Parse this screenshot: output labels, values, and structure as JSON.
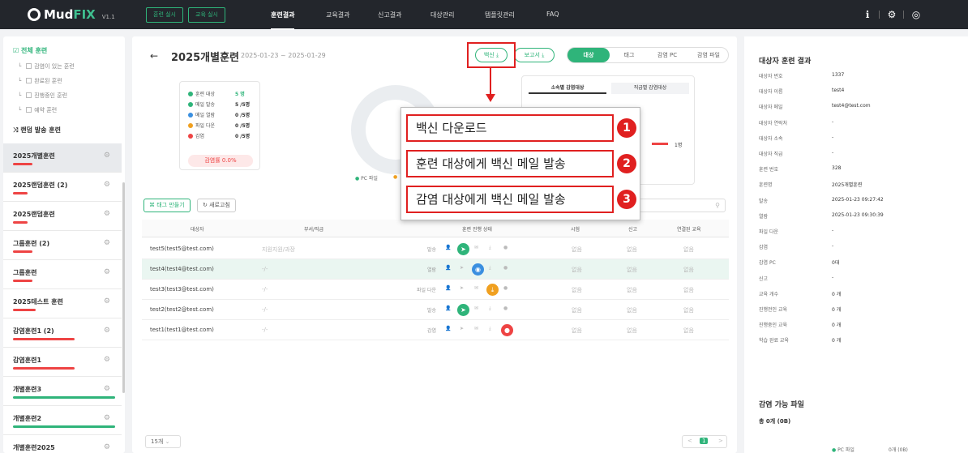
{
  "topbar": {
    "logo": "MudFIX",
    "version": "V1.1",
    "btn_training": "훈련 실시",
    "btn_education": "교육 실시",
    "nav": [
      "훈련결과",
      "교육결과",
      "신고결과",
      "대상관리",
      "템플릿관리",
      "FAQ"
    ]
  },
  "sidebar": {
    "all_training": "전체 훈련",
    "subs": [
      "감염이 있는 훈련",
      "완료된 훈련",
      "진행중인 훈련",
      "예약 훈련"
    ],
    "random": "랜덤 발송 훈련",
    "items": [
      {
        "name": "2025개별훈련",
        "bar": "#e44",
        "barw": 24
      },
      {
        "name": "2025랜덤훈련 (2)",
        "bar": "#e44",
        "barw": 18
      },
      {
        "name": "2025랜덤훈련",
        "bar": "#e44",
        "barw": 18
      },
      {
        "name": "그룹훈련 (2)",
        "bar": "#e44",
        "barw": 24
      },
      {
        "name": "그룹훈련",
        "bar": "#e44",
        "barw": 24
      },
      {
        "name": "2025테스트 훈련",
        "bar": "#e44",
        "barw": 28
      },
      {
        "name": "감염훈련1 (2)",
        "bar": "#e44",
        "barw": 76
      },
      {
        "name": "감염훈련1",
        "bar": "#e44",
        "barw": 76
      },
      {
        "name": "개별훈련3",
        "bar": "#2fb47a",
        "barw": 126
      },
      {
        "name": "개별훈련2",
        "bar": "#2fb47a",
        "barw": 126
      },
      {
        "name": "개별훈련2025",
        "bar": "#2fb47a",
        "barw": 126
      }
    ]
  },
  "main": {
    "title": "2025개별훈련",
    "dates": "2025-01-23 ~ 2025-01-29",
    "btn_vaccine": "백신 ⤓",
    "btn_report": "보고서 ⤓",
    "toggle": [
      "대상",
      "태그",
      "감염 PC",
      "감염 파일"
    ],
    "stats": [
      {
        "label": "훈련 대상",
        "value": "5 명",
        "color": "#2fb47a"
      },
      {
        "label": "메일 발송",
        "value": "5 /5명",
        "color": "#2fb47a"
      },
      {
        "label": "메일 열람",
        "value": "0 /5명",
        "color": "#3a8fe0"
      },
      {
        "label": "파일 다운",
        "value": "0 /5명",
        "color": "#f0a020"
      },
      {
        "label": "감염",
        "value": "0 /5명",
        "color": "#e44"
      }
    ],
    "infection_rate": "감염률 0.0%",
    "legend_pc": "PC 파일",
    "rtabs": [
      "소속별 감염대상",
      "직급별 감염대상"
    ],
    "rbar_label": "1명",
    "btn_tag": "태그 만들기",
    "btn_refresh": "새로고침",
    "headers": [
      "대상자",
      "부서/직급",
      "훈련 진행 상태",
      "시험",
      "신고",
      "연결된 교육"
    ],
    "rows": [
      {
        "name": "test5(test5@test.com)",
        "dept": "지원지원/과장",
        "status": "발송",
        "step": 1,
        "col": "#2fb47a",
        "icon": "➤",
        "c1": "없음",
        "c2": "없음",
        "c3": "없음"
      },
      {
        "name": "test4(test4@test.com)",
        "dept": "-/-",
        "status": "열람",
        "step": 2,
        "col": "#3a8fe0",
        "icon": "◉",
        "c1": "없음",
        "c2": "없음",
        "c3": "없음"
      },
      {
        "name": "test3(test3@test.com)",
        "dept": "-/-",
        "status": "파일 다운",
        "step": 3,
        "col": "#f0a020",
        "icon": "⤓",
        "c1": "없음",
        "c2": "없음",
        "c3": "없음"
      },
      {
        "name": "test2(test2@test.com)",
        "dept": "-/-",
        "status": "발송",
        "step": 1,
        "col": "#2fb47a",
        "icon": "➤",
        "c1": "없음",
        "c2": "없음",
        "c3": "없음"
      },
      {
        "name": "test1(test1@test.com)",
        "dept": "-/-",
        "status": "감염",
        "step": 4,
        "col": "#e44",
        "icon": "●",
        "c1": "없음",
        "c2": "없음",
        "c3": "없음"
      }
    ],
    "page_size": "15개",
    "page": "1"
  },
  "right": {
    "title": "대상자 훈련 결과",
    "fields": [
      [
        "대상자 번호",
        "1337"
      ],
      [
        "대상자 이름",
        "test4"
      ],
      [
        "대상자 메일",
        "test4@test.com"
      ],
      [
        "대상자 연락처",
        "-"
      ],
      [
        "대상자 소속",
        "-"
      ],
      [
        "대상자 직급",
        "-"
      ],
      [
        "훈련 번호",
        "328"
      ],
      [
        "훈련명",
        "2025개별훈련"
      ],
      [
        "발송",
        "2025-01-23 09:27:42"
      ],
      [
        "열람",
        "2025-01-23 09:30:39"
      ],
      [
        "파일 다운",
        "-"
      ],
      [
        "감염",
        "-"
      ],
      [
        "감염 PC",
        "0대"
      ],
      [
        "신고",
        "-"
      ],
      [
        "교육 개수",
        "0 개"
      ],
      [
        "진행전인 교육",
        "0 개"
      ],
      [
        "진행중인 교육",
        "0 개"
      ],
      [
        "학습 완료 교육",
        "0 개"
      ]
    ],
    "files_title": "감염 가능 파일",
    "files_total": "총 0개 (0B)",
    "files_legend": "PC 파일",
    "files_legend_val": "0개 (0B)"
  },
  "callout": {
    "items": [
      "백신 다운로드",
      "훈련 대상에게 백신 메일 발송",
      "감염 대상에게 백신 메일 발송"
    ],
    "nums": [
      "1",
      "2",
      "3"
    ]
  }
}
